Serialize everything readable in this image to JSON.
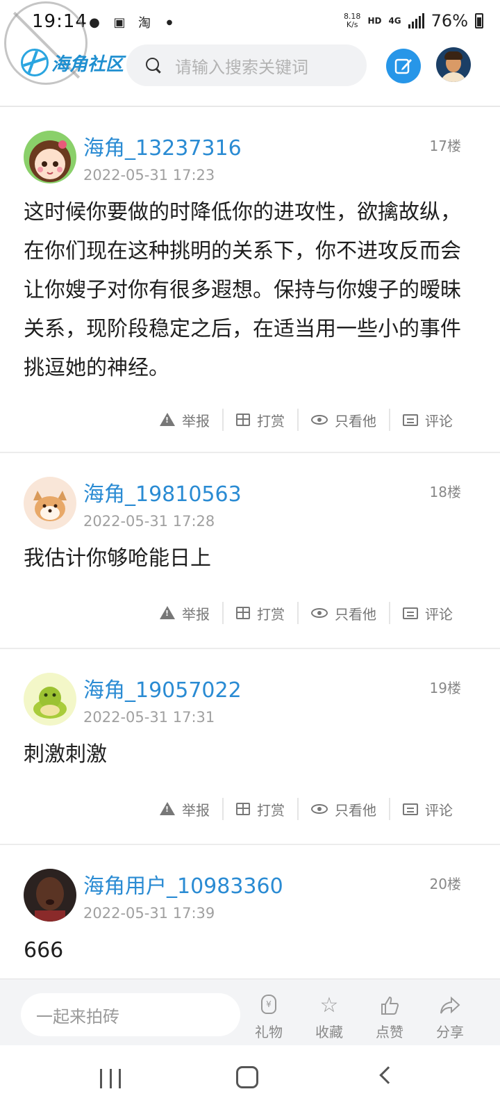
{
  "status_bar": {
    "time": "19:14",
    "net_speed_value": "8.18",
    "net_speed_unit": "K/s",
    "hd": "HD",
    "network": "4G",
    "battery": "76%"
  },
  "header": {
    "logo_text": "海角社区",
    "search_placeholder": "请输入搜索关键词"
  },
  "posts": [
    {
      "user": "海角_13237316",
      "floor": "17楼",
      "time": "2022-05-31 17:23",
      "content": "这时候你要做的时降低你的进攻性，欲擒故纵，在你们现在这种挑明的关系下，你不进攻反而会让你嫂子对你有很多遐想。保持与你嫂子的暧昧关系，现阶段稳定之后，在适当用一些小的事件挑逗她的神经。"
    },
    {
      "user": "海角_19810563",
      "floor": "18楼",
      "time": "2022-05-31 17:28",
      "content": "我估计你够呛能日上"
    },
    {
      "user": "海角_19057022",
      "floor": "19楼",
      "time": "2022-05-31 17:31",
      "content": "刺激刺激"
    },
    {
      "user": "海角用户_10983360",
      "floor": "20楼",
      "time": "2022-05-31 17:39",
      "content": "666"
    }
  ],
  "actions": {
    "report": "举报",
    "reward": "打赏",
    "only_him": "只看他",
    "comment": "评论"
  },
  "comment_bar": {
    "placeholder": "一起来拍砖",
    "gift": "礼物",
    "favorite": "收藏",
    "like": "点赞",
    "share": "分享"
  }
}
